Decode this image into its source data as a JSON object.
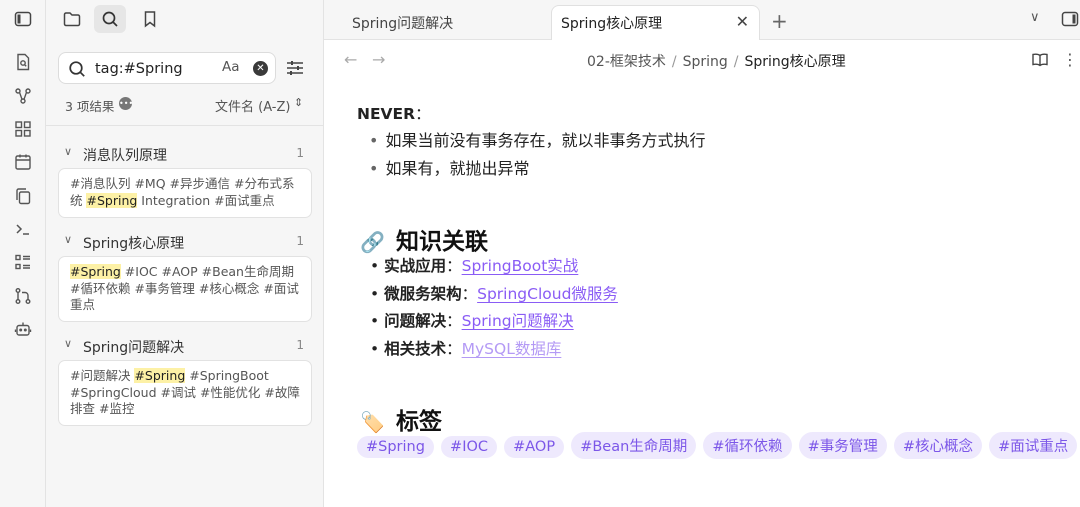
{
  "sidebar": {
    "search": {
      "query": "tag:#Spring",
      "match_case_label": "Aa",
      "clear_label": "✕"
    },
    "results": {
      "count_label": "3 项结果",
      "sort_label": "文件名 (A-Z)"
    },
    "groups": [
      {
        "title": "消息队列原理",
        "count": "1",
        "snippet_before": "#消息队列 #MQ #异步通信 #分布式系统 ",
        "snippet_highlight": "#Spring",
        "snippet_after": " Integration #面试重点"
      },
      {
        "title": "Spring核心原理",
        "count": "1",
        "snippet_before": "",
        "snippet_highlight": "#Spring",
        "snippet_after": " #IOC #AOP #Bean生命周期 #循环依赖 #事务管理 #核心概念 #面试重点"
      },
      {
        "title": "Spring问题解决",
        "count": "1",
        "snippet_before": "#问题解决 ",
        "snippet_highlight": "#Spring",
        "snippet_after": " #SpringBoot #SpringCloud #调试 #性能优化 #故障排查 #监控"
      }
    ]
  },
  "tabs": [
    {
      "label": "Spring问题解决",
      "active": false
    },
    {
      "label": "Spring核心原理",
      "active": true
    }
  ],
  "breadcrumb": {
    "folder": "02-框架技术",
    "subfolder": "Spring",
    "current": "Spring核心原理",
    "separator": "/"
  },
  "note": {
    "never": {
      "label": "NEVER",
      "colon": "：",
      "bullets": [
        "如果当前没有事务存在，就以非事务方式执行",
        "如果有，就抛出异常"
      ]
    },
    "knowledge": {
      "emoji": "🔗",
      "heading": "知识关联",
      "items": [
        {
          "key": "实战应用",
          "sep": "：",
          "link": "SpringBoot实战"
        },
        {
          "key": "微服务架构",
          "sep": "：",
          "link": "SpringCloud微服务"
        },
        {
          "key": "问题解决",
          "sep": "：",
          "link": "Spring问题解决"
        },
        {
          "key": "相关技术",
          "sep": "：",
          "link": "MySQL数据库"
        }
      ]
    },
    "tags_section": {
      "emoji": "🏷️",
      "heading": "标签",
      "tags": [
        "#Spring",
        "#IOC",
        "#AOP",
        "#Bean生命周期",
        "#循环依赖",
        "#事务管理",
        "#核心概念",
        "#面试重点"
      ]
    }
  },
  "colors": {
    "accent": "#8a5cf5",
    "tag_bg": "#eee9fd",
    "highlight": "#fdf1a6"
  }
}
